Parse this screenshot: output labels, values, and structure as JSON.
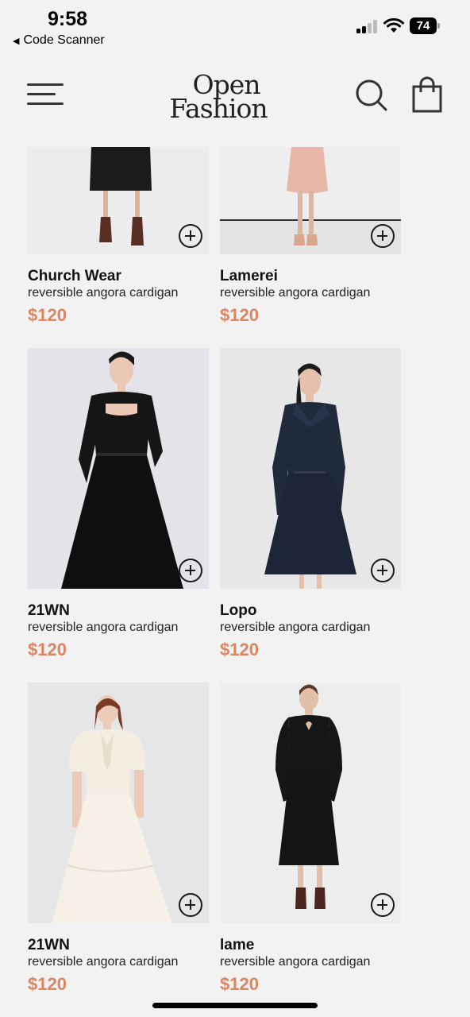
{
  "status_bar": {
    "time": "9:58",
    "back_app": "Code Scanner",
    "battery": "74"
  },
  "header": {
    "logo_line1": "Open",
    "logo_line2": "Fashion",
    "menu_icon": "hamburger-icon",
    "search_icon": "search-icon",
    "bag_icon": "shopping-bag-icon"
  },
  "products": [
    {
      "name": "Church Wear",
      "description": "reversible angora cardigan",
      "price": "$120"
    },
    {
      "name": "Lamerei",
      "description": "reversible angora cardigan",
      "price": "$120"
    },
    {
      "name": "21WN",
      "description": "reversible angora cardigan",
      "price": "$120"
    },
    {
      "name": "Lopo",
      "description": "reversible angora cardigan",
      "price": "$120"
    },
    {
      "name": "21WN",
      "description": "reversible angora cardigan",
      "price": "$120"
    },
    {
      "name": "lame",
      "description": "reversible angora cardigan",
      "price": "$120"
    }
  ],
  "colors": {
    "background": "#f2f2f2",
    "price": "#dd8560",
    "text": "#111111"
  }
}
